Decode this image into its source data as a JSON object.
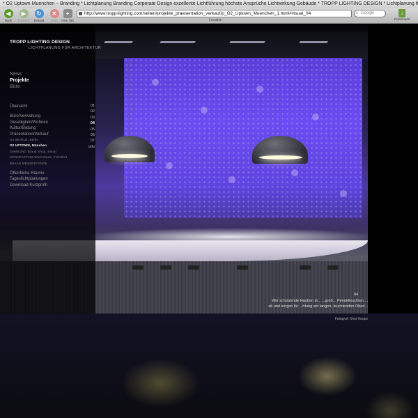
{
  "browser": {
    "title": "* O2 Uptown Muenchen – Branding * Lichtplanung Branding Corporate Design exzellente Lichtführung höchste Ansprüche Lichtwirkung Gebäude * TROPP LIGHTING DESIGN * Lichtplanung für Architektur",
    "buttons": {
      "back": "Back",
      "forward": "Forward",
      "reload": "Reload",
      "stop": "Stop",
      "new_tab": "New Tab",
      "downloads": "Downloads"
    },
    "url": "http://www.tropp-lighting.com/seiten/projekte_praesentation_verkauf/p_O2_Uptown_Muenchen_1.html#visual_04",
    "location_label": "Location",
    "search_placeholder": "Google"
  },
  "site": {
    "brand": "TROPP LIGHTING DESIGN",
    "tagline": "LICHTPLANUNG FÜR ARCHITEKTUR",
    "main_nav": [
      "News",
      "Projekte",
      "Büro"
    ],
    "active_nav": "Projekte",
    "overview": "Übersicht",
    "categories": [
      "Büro/Verwaltung",
      "Geselligkeit/Wohnen",
      "Kultur/Bildung",
      "Präsentation/Verkauf"
    ],
    "sub_items": [
      "O2 WORLD, Berlin",
      "O2 UPTOWN, München",
      "SAMSUNG Brand Shop, Seoul",
      "MANUFACTUM Warenhaus, Frankfurt",
      "BRAAS MESSESTÄNDE"
    ],
    "more_categories": [
      "Öffentliche Räume",
      "Tageslichtplanungen",
      "Download Kurzprofil"
    ],
    "image_numbers": [
      "01",
      "02",
      "03",
      "04",
      "05",
      "06",
      "07",
      "info"
    ],
    "selected_number": "04"
  },
  "caption": {
    "number": "04",
    "line1": "Wie schützende Hauben st... ...groß... Pendelleuchten ...",
    "line2": "ab und sorgen für ...htung am langen, leuchtenden Oberl...",
    "credit": "Fotograf: Knut Koops"
  },
  "colors": {
    "wall_violet": "#6a4cf0",
    "accent": "#ffffff"
  }
}
